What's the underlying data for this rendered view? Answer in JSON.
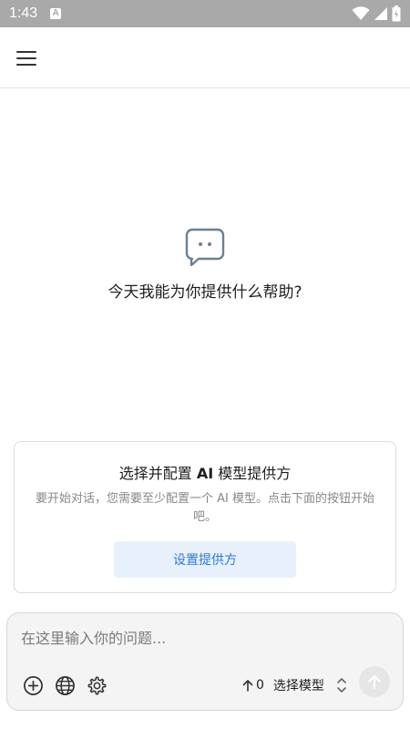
{
  "status_bar": {
    "time": "1:43",
    "notification_badge": "A"
  },
  "header": {
    "menu_icon": "hamburger-menu-icon"
  },
  "empty_state": {
    "icon": "chat-bubble-icon",
    "title": "今天我能为你提供什么帮助?"
  },
  "provider_card": {
    "title_prefix": "选择并配置 ",
    "title_bold": "AI",
    "title_suffix": " 模型提供方",
    "description": "要开始对话，您需要至少配置一个 AI 模型。点击下面的按钮开始吧。",
    "button_label": "设置提供方"
  },
  "composer": {
    "placeholder": "在这里输入你的问题...",
    "tools": [
      "add-icon",
      "globe-icon",
      "settings-icon"
    ],
    "model_count": "0",
    "model_select_label": "选择模型"
  },
  "colors": {
    "status_bar_bg": "#a9a9a9",
    "accent": "#2d7ad6",
    "button_bg": "#e8f1fb",
    "composer_bg": "#f4f4f4"
  }
}
